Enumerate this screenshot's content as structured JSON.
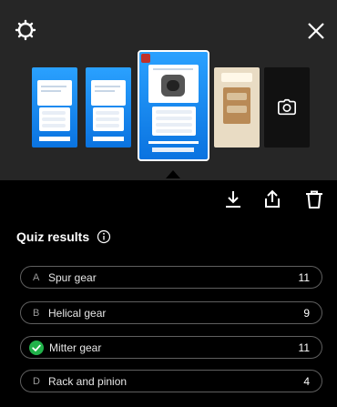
{
  "header": {
    "close_icon": "close-icon",
    "settings_icon": "settings-icon"
  },
  "thumbnails": [
    {
      "kind": "quiz-story",
      "selected": false
    },
    {
      "kind": "quiz-story",
      "selected": false
    },
    {
      "kind": "quiz-story",
      "selected": true
    },
    {
      "kind": "photo",
      "selected": false
    },
    {
      "kind": "add-camera",
      "icon": "camera-icon"
    }
  ],
  "actions": {
    "download_icon": "download-icon",
    "share_icon": "share-icon",
    "delete_icon": "trash-icon"
  },
  "quiz": {
    "title": "Quiz results",
    "options": [
      {
        "letter": "A",
        "label": "Spur gear",
        "count": "11",
        "correct": false
      },
      {
        "letter": "B",
        "label": "Helical gear",
        "count": "9",
        "correct": false
      },
      {
        "letter": "",
        "label": "Mitter gear",
        "count": "11",
        "correct": true
      },
      {
        "letter": "D",
        "label": "Rack and pinion",
        "count": "4",
        "correct": false
      }
    ]
  },
  "colors": {
    "correct": "#21b24a",
    "story_blue": "#1a8cf0"
  }
}
